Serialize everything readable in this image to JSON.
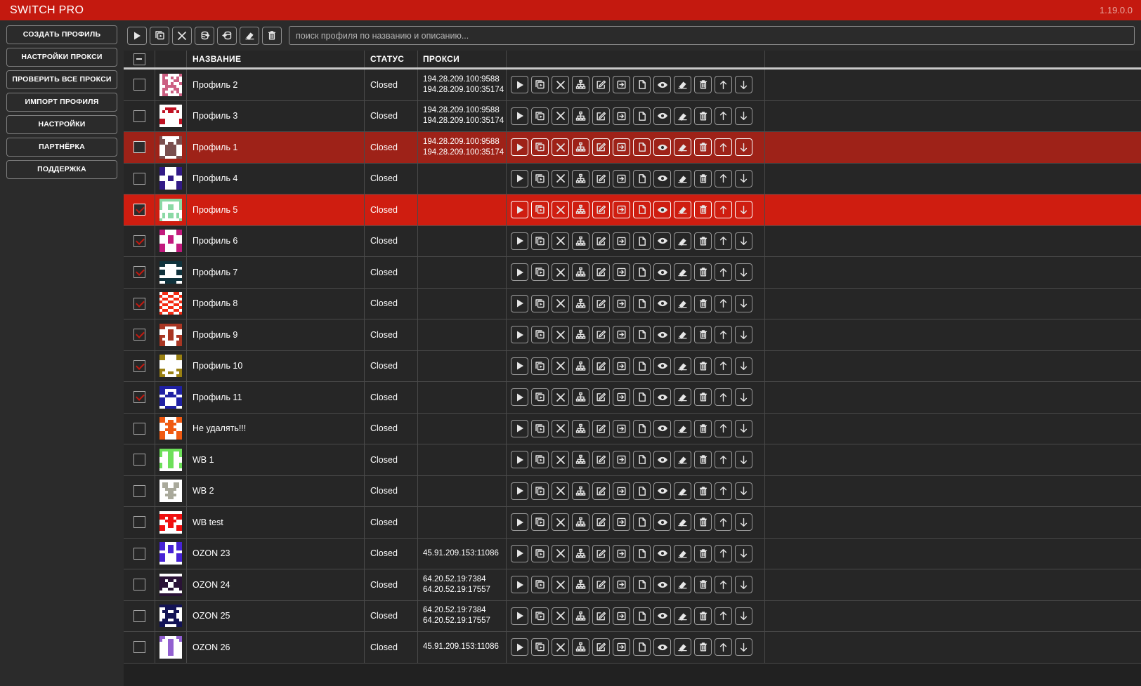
{
  "window": {
    "title": "SWITCH PRO",
    "version": "1.19.0.0",
    "accent_color": "#c4190f",
    "selected_row_color": "#cf1d10",
    "hovered_row_color": "#9e2218",
    "background_color": "#262626"
  },
  "sidebar": {
    "items": [
      {
        "label": "СОЗДАТЬ ПРОФИЛЬ",
        "name": "create-profile"
      },
      {
        "label": "НАСТРОЙКИ ПРОКСИ",
        "name": "proxy-settings"
      },
      {
        "label": "ПРОВЕРИТЬ ВСЕ ПРОКСИ",
        "name": "check-all-proxies"
      },
      {
        "label": "ИМПОРТ ПРОФИЛЯ",
        "name": "import-profile"
      },
      {
        "label": "НАСТРОЙКИ",
        "name": "settings"
      },
      {
        "label": "ПАРТНЁРКА",
        "name": "affiliate"
      },
      {
        "label": "ПОДДЕРЖКА",
        "name": "support"
      }
    ]
  },
  "toolbar": {
    "buttons": [
      {
        "icon": "play-icon",
        "tip": "start"
      },
      {
        "icon": "duplicate-icon",
        "tip": "duplicate"
      },
      {
        "icon": "close-icon",
        "tip": "stop"
      },
      {
        "icon": "proxy-out-icon",
        "tip": "proxy-export"
      },
      {
        "icon": "proxy-in-icon",
        "tip": "proxy-import"
      },
      {
        "icon": "eraser-icon",
        "tip": "clear-cache"
      },
      {
        "icon": "trash-icon",
        "tip": "delete"
      }
    ],
    "search_placeholder": "поиск профиля по названию и описанию...",
    "search_value": ""
  },
  "table": {
    "headers": {
      "select_all": "select-all",
      "avatar": "",
      "name": "НАЗВАНИЕ",
      "status": "СТАТУС",
      "proxy": "ПРОКСИ",
      "actions": ""
    },
    "row_actions": [
      {
        "icon": "play-icon",
        "label": "start"
      },
      {
        "icon": "duplicate-icon",
        "label": "duplicate"
      },
      {
        "icon": "close-icon",
        "label": "stop"
      },
      {
        "icon": "sitemap-icon",
        "label": "proxy"
      },
      {
        "icon": "edit-icon",
        "label": "edit"
      },
      {
        "icon": "login-icon",
        "label": "import-cookies"
      },
      {
        "icon": "copy-icon",
        "label": "copy"
      },
      {
        "icon": "eye-icon",
        "label": "preview"
      },
      {
        "icon": "eraser-icon",
        "label": "clear"
      },
      {
        "icon": "trash-icon",
        "label": "delete"
      },
      {
        "icon": "arrow-up-icon",
        "label": "move-up"
      },
      {
        "icon": "arrow-down-icon",
        "label": "move-down"
      }
    ],
    "rows": [
      {
        "name": "Профиль 2",
        "status": "Closed",
        "proxies": [
          "194.28.209.100:9588",
          "194.28.209.100:35174"
        ],
        "checked": false,
        "state": "normal",
        "avatar": {
          "bg": "#ffffff",
          "fg": "#cc5f82",
          "bits": "0110000101001010011001100110100100111100011001100100101001100001"
        }
      },
      {
        "name": "Профиль 3",
        "status": "Closed",
        "proxies": [
          "194.28.209.100:9588",
          "194.28.209.100:35174"
        ],
        "checked": false,
        "state": "normal",
        "avatar": {
          "bg": "#ffffff",
          "fg": "#c01122",
          "bits": "0000000000111100010110100000000000000000110000011100000100000000"
        }
      },
      {
        "name": "Профиль 1",
        "status": "Closed",
        "proxies": [
          "194.28.209.100:9588",
          "194.28.209.100:35174"
        ],
        "checked": false,
        "state": "hovered",
        "avatar": {
          "bg": "#ffffff",
          "fg": "#7a4f4f",
          "bits": "1000000111000011110110110011110000111100001111000011110011000011"
        }
      },
      {
        "name": "Профиль 4",
        "status": "Closed",
        "proxies": [],
        "checked": false,
        "state": "normal",
        "avatar": {
          "bg": "#ffffff",
          "fg": "#321a87",
          "bits": "1100001111000011110000110001100000011000110000111100001111000011"
        }
      },
      {
        "name": "Профиль 5",
        "status": "Closed",
        "proxies": [],
        "checked": true,
        "state": "selected",
        "avatar": {
          "bg": "#ffffff",
          "fg": "#8ad9a5",
          "bits": "1111111110000001100110011001100100000000010110100101101010000001"
        }
      },
      {
        "name": "Профиль 6",
        "status": "Closed",
        "proxies": [],
        "checked": true,
        "state": "normal",
        "avatar": {
          "bg": "#ffffff",
          "fg": "#c21a7e",
          "bits": "1100001111000011000110000001100000011000110000111100001111000011"
        }
      },
      {
        "name": "Профиль 7",
        "status": "Closed",
        "proxies": [],
        "checked": true,
        "state": "normal",
        "avatar": {
          "bg": "#ffffff",
          "fg": "#10333d",
          "bits": "1111111111000011000000001100001111000011000000001111111100111100"
        }
      },
      {
        "name": "Профиль 8",
        "status": "Closed",
        "proxies": [],
        "checked": true,
        "state": "normal",
        "avatar": {
          "bg": "#ffffff",
          "fg": "#f42b13",
          "bits": "0110011010011001011001101001100101100110100110010110011010011001"
        }
      },
      {
        "name": "Профиль 9",
        "status": "Closed",
        "proxies": [],
        "checked": true,
        "state": "normal",
        "avatar": {
          "bg": "#ffffff",
          "fg": "#a93623",
          "bits": "1111111111000011000110000001100011011011100110011100001111000011"
        }
      },
      {
        "name": "Профиль 10",
        "status": "Closed",
        "proxies": [],
        "checked": true,
        "state": "normal",
        "avatar": {
          "bg": "#ffffff",
          "fg": "#9a8112",
          "bits": "1100001111000011000000000000000000000000110000111001100111000011"
        }
      },
      {
        "name": "Профиль 11",
        "status": "Closed",
        "proxies": [],
        "checked": true,
        "state": "normal",
        "avatar": {
          "bg": "#ffffff",
          "fg": "#2021a5",
          "bits": "1111111111000011110110110011110011000011110000111100001100111100"
        }
      },
      {
        "name": "Не удалять!!!",
        "status": "Closed",
        "proxies": [],
        "checked": false,
        "state": "normal",
        "avatar": {
          "bg": "#ffffff",
          "fg": "#f05a12",
          "bits": "1100001111011011001111000001100000111100110110111100001111000011"
        }
      },
      {
        "name": "WB 1",
        "status": "Closed",
        "proxies": [],
        "checked": false,
        "state": "normal",
        "avatar": {
          "bg": "#ffffff",
          "fg": "#6de05a",
          "bits": "1111111110011001100110010001100000011000100110011001100100000000"
        }
      },
      {
        "name": "WB 2",
        "status": "Closed",
        "proxies": [],
        "checked": false,
        "state": "normal",
        "avatar": {
          "bg": "#ffffff",
          "fg": "#a9a99b",
          "bits": "0000000001100110011001100011110000011000001111000001100000000000"
        }
      },
      {
        "name": "WB test",
        "status": "Closed",
        "proxies": [],
        "checked": false,
        "state": "normal",
        "avatar": {
          "bg": "#ffffff",
          "fg": "#f01010",
          "bits": "0000000011111111110110110011110000011000110110111100001100000000"
        }
      },
      {
        "name": "OZON 23",
        "status": "Closed",
        "proxies": [
          "45.91.209.153:11086"
        ],
        "checked": false,
        "state": "normal",
        "avatar": {
          "bg": "#ffffff",
          "fg": "#4723d6",
          "bits": "1100001111011011110110110001100011000011110000111100001100000000"
        }
      },
      {
        "name": "OZON 24",
        "status": "Closed",
        "proxies": [
          "64.20.52.19:7384",
          "64.20.52.19:17557"
        ],
        "checked": false,
        "state": "normal",
        "avatar": {
          "bg": "#ffffff",
          "fg": "#2a1236",
          "bits": "0000000011111111110110111110011111100111100110010000000011111111"
        }
      },
      {
        "name": "OZON 25",
        "status": "Closed",
        "proxies": [
          "64.20.52.19:7384",
          "64.20.52.19:17557"
        ],
        "checked": false,
        "state": "normal",
        "avatar": {
          "bg": "#ffffff",
          "fg": "#131355",
          "bits": "1111111100111100011001100011110000111100011001101111111111000011"
        }
      },
      {
        "name": "OZON 26",
        "status": "Closed",
        "proxies": [
          "45.91.209.153:11086"
        ],
        "checked": false,
        "state": "normal",
        "avatar": {
          "bg": "#ffffff",
          "fg": "#9260d0",
          "bits": "1100001110011001000110000001100000011000000110000001100000000000"
        }
      }
    ]
  }
}
